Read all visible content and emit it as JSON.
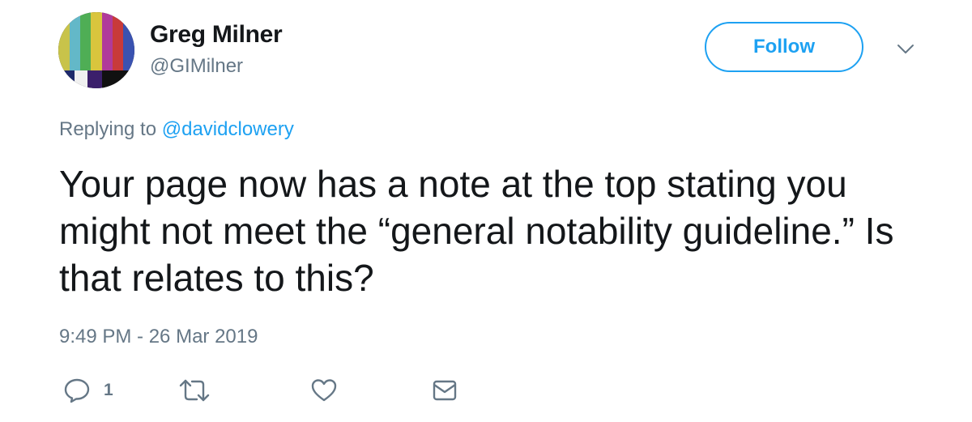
{
  "user": {
    "display_name": "Greg Milner",
    "handle": "@GIMilner"
  },
  "follow_button_label": "Follow",
  "reply_context": {
    "prefix": "Replying to ",
    "handle": "@davidclowery"
  },
  "tweet": {
    "text": "Your page now has a note at the top stating you might not meet the “general notability guideline.” Is that relates to this?",
    "timestamp": "9:49 PM - 26 Mar 2019"
  },
  "actions": {
    "reply_count": "1"
  },
  "colors": {
    "accent": "#1da1f2",
    "secondary_text": "#657786",
    "primary_text": "#14171a"
  },
  "icons": [
    "avatar-color-bars",
    "chevron-down-icon",
    "reply-icon",
    "retweet-icon",
    "heart-icon",
    "envelope-icon"
  ]
}
